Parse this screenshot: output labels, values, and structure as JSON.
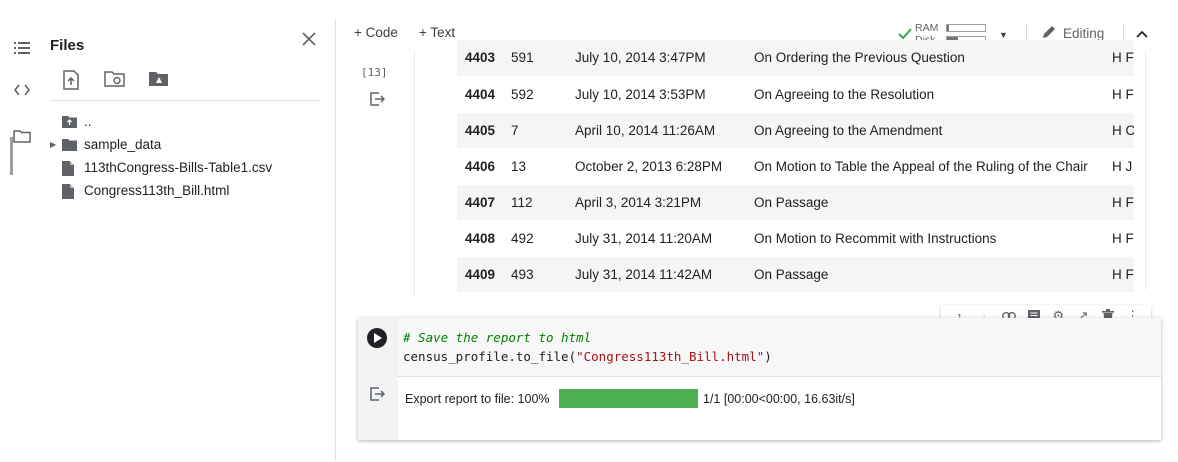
{
  "files": {
    "title": "Files",
    "tree": [
      {
        "label": "..",
        "type": "folder-up"
      },
      {
        "label": "sample_data",
        "type": "folder",
        "expandable": true
      },
      {
        "label": "113thCongress-Bills-Table1.csv",
        "type": "file"
      },
      {
        "label": "Congress113th_Bill.html",
        "type": "file"
      }
    ]
  },
  "toolbar": {
    "code_label": "+ Code",
    "text_label": "+ Text",
    "ram_label": "RAM",
    "disk_label": "Disk",
    "ram_usage": 0.05,
    "disk_usage": 0.3,
    "editing_label": "Editing"
  },
  "output_cell": {
    "exec_count": "[13]",
    "rows": [
      {
        "index": "4403",
        "num": "591",
        "date": "July 10, 2014 3:47PM",
        "question": "On Ordering the Previous Question",
        "extra": "H F"
      },
      {
        "index": "4404",
        "num": "592",
        "date": "July 10, 2014 3:53PM",
        "question": "On Agreeing to the Resolution",
        "extra": "H F"
      },
      {
        "index": "4405",
        "num": "7",
        "date": "April 10, 2014 11:26AM",
        "question": "On Agreeing to the Amendment",
        "extra": "H C"
      },
      {
        "index": "4406",
        "num": "13",
        "date": "October 2, 2013 6:28PM",
        "question": "On Motion to Table the Appeal of the Ruling of the Chair",
        "extra": "H J"
      },
      {
        "index": "4407",
        "num": "112",
        "date": "April 3, 2014 3:21PM",
        "question": "On Passage",
        "extra": "H F"
      },
      {
        "index": "4408",
        "num": "492",
        "date": "July 31, 2014 11:20AM",
        "question": "On Motion to Recommit with Instructions",
        "extra": "H F"
      },
      {
        "index": "4409",
        "num": "493",
        "date": "July 31, 2014 11:42AM",
        "question": "On Passage",
        "extra": "H F"
      }
    ]
  },
  "code_cell": {
    "comment": "# Save the report to html",
    "code_prefix": "census_profile.to_file(",
    "code_string": "\"Congress113th_Bill.html\"",
    "code_suffix": ")",
    "progress_label": "Export report to file: 100%",
    "progress_value": 1.0,
    "progress_stats": "1/1 [00:00<00:00, 16.63it/s]"
  },
  "colors": {
    "progress_fill": "#4caf50",
    "check_green": "#34a853",
    "comment_green": "#008000",
    "string_red": "#a31515"
  }
}
